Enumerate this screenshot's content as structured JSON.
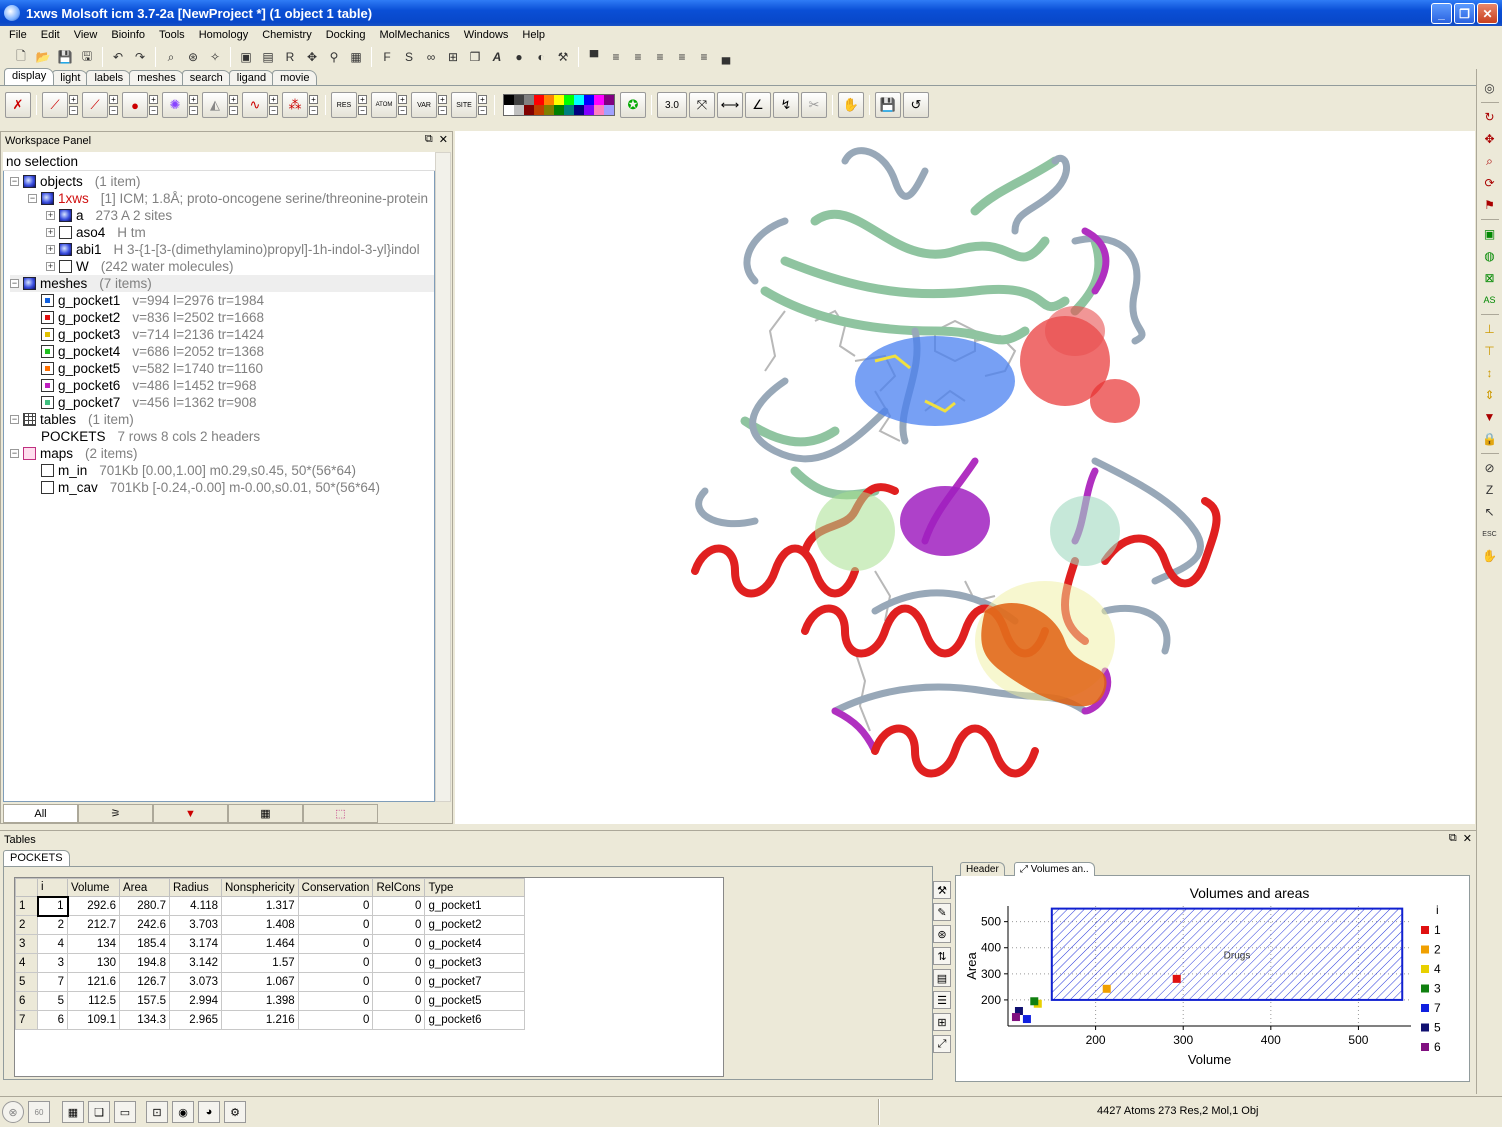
{
  "window": {
    "title": "1xws Molsoft icm 3.7-2a  [NewProject *] (1 object 1 table)",
    "min": "_",
    "max": "❐",
    "close": "✕"
  },
  "menu": [
    "File",
    "Edit",
    "View",
    "Bioinfo",
    "Tools",
    "Homology",
    "Chemistry",
    "Docking",
    "MolMechanics",
    "Windows",
    "Help"
  ],
  "tool_tabs": [
    "display",
    "light",
    "labels",
    "meshes",
    "search",
    "ligand",
    "movie"
  ],
  "toolbar": {
    "size_value": "3.0",
    "res_label": "RES",
    "atom_label": "ATOM",
    "var_label": "VAR",
    "site_label": "SITE"
  },
  "palette": [
    "#000000",
    "#404040",
    "#808080",
    "#ff0000",
    "#ff8000",
    "#ffff00",
    "#00ff00",
    "#00ffff",
    "#0000ff",
    "#ff00ff",
    "#800080",
    "#ffffff",
    "#c0c0c0",
    "#800000",
    "#c04000",
    "#808000",
    "#008000",
    "#008080",
    "#000080",
    "#8000ff",
    "#ff80c0",
    "#a0a0ff"
  ],
  "workspace": {
    "title": "Workspace Panel",
    "selection": "no selection",
    "rows": [
      {
        "label": "objects",
        "info": "(1 item)"
      },
      {
        "label": "1xws",
        "info": "[1] ICM; 1.8Å; proto-oncogene serine/threonine-protein"
      },
      {
        "label": "a",
        "info": "273 A  2 sites"
      },
      {
        "label": "aso4",
        "info": "H    tm"
      },
      {
        "label": "abi1",
        "info": "H    3-{1-[3-(dimethylamino)propyl]-1h-indol-3-yl}indol"
      },
      {
        "label": "W",
        "info": "(242 water molecules)"
      },
      {
        "label": "meshes",
        "info": "(7 items)"
      },
      {
        "label": "g_pocket1",
        "info": "v=994 l=2976 tr=1984"
      },
      {
        "label": "g_pocket2",
        "info": "v=836 l=2502 tr=1668"
      },
      {
        "label": "g_pocket3",
        "info": "v=714 l=2136 tr=1424"
      },
      {
        "label": "g_pocket4",
        "info": "v=686 l=2052 tr=1368"
      },
      {
        "label": "g_pocket5",
        "info": "v=582 l=1740 tr=1160"
      },
      {
        "label": "g_pocket6",
        "info": "v=486 l=1452 tr=968"
      },
      {
        "label": "g_pocket7",
        "info": "v=456 l=1362 tr=908"
      },
      {
        "label": "tables",
        "info": "(1 item)"
      },
      {
        "label": "POCKETS",
        "info": "7 rows 8 cols 2 headers"
      },
      {
        "label": "maps",
        "info": "(2 items)"
      },
      {
        "label": "m_in",
        "info": "701Kb [0.00,1.00] m0.29,s0.45, 50*(56*64)"
      },
      {
        "label": "m_cav",
        "info": "701Kb [-0.24,-0.00] m-0.00,s0.01, 50*(56*64)"
      }
    ],
    "mesh_colors": [
      "#1060e0",
      "#e01010",
      "#e0c000",
      "#20c020",
      "#ff7000",
      "#c020c0",
      "#40c080"
    ],
    "bottom_tabs": [
      "All"
    ]
  },
  "tables_panel": {
    "title": "Tables",
    "tab": "POCKETS",
    "columns": [
      "i",
      "Volume",
      "Area",
      "Radius",
      "Nonsphericity",
      "Conservation",
      "RelCons",
      "Type"
    ],
    "rows": [
      [
        "1",
        "1",
        "292.6",
        "280.7",
        "4.118",
        "1.317",
        "0",
        "0",
        "g_pocket1"
      ],
      [
        "2",
        "2",
        "212.7",
        "242.6",
        "3.703",
        "1.408",
        "0",
        "0",
        "g_pocket2"
      ],
      [
        "3",
        "4",
        "134",
        "185.4",
        "3.174",
        "1.464",
        "0",
        "0",
        "g_pocket4"
      ],
      [
        "4",
        "3",
        "130",
        "194.8",
        "3.142",
        "1.57",
        "0",
        "0",
        "g_pocket3"
      ],
      [
        "5",
        "7",
        "121.6",
        "126.7",
        "3.073",
        "1.067",
        "0",
        "0",
        "g_pocket7"
      ],
      [
        "6",
        "5",
        "112.5",
        "157.5",
        "2.994",
        "1.398",
        "0",
        "0",
        "g_pocket5"
      ],
      [
        "7",
        "6",
        "109.1",
        "134.3",
        "2.965",
        "1.216",
        "0",
        "0",
        "g_pocket6"
      ]
    ]
  },
  "chart_tabs": [
    "Header",
    "Volumes an.."
  ],
  "chart_data": {
    "type": "scatter",
    "title": "Volumes and areas",
    "xlabel": "Volume",
    "ylabel": "Area",
    "xlim": [
      100,
      560
    ],
    "ylim": [
      100,
      560
    ],
    "xticks": [
      200,
      300,
      400,
      500
    ],
    "yticks": [
      200,
      300,
      400,
      500
    ],
    "region": {
      "label": "Drugs",
      "x": [
        150,
        550
      ],
      "y": [
        200,
        550
      ]
    },
    "legend_title": "i",
    "series": [
      {
        "name": "1",
        "x": 292.6,
        "y": 280.7,
        "color": "#e01010"
      },
      {
        "name": "2",
        "x": 212.7,
        "y": 242.6,
        "color": "#f0a000"
      },
      {
        "name": "4",
        "x": 134,
        "y": 185.4,
        "color": "#e8d000"
      },
      {
        "name": "3",
        "x": 130,
        "y": 194.8,
        "color": "#108010"
      },
      {
        "name": "7",
        "x": 121.6,
        "y": 126.7,
        "color": "#1020e0"
      },
      {
        "name": "5",
        "x": 112.5,
        "y": 157.5,
        "color": "#101070"
      },
      {
        "name": "6",
        "x": 109.1,
        "y": 134.3,
        "color": "#801080"
      }
    ]
  },
  "status": {
    "text": "4427 Atoms 273 Res,2 Mol,1 Obj"
  }
}
